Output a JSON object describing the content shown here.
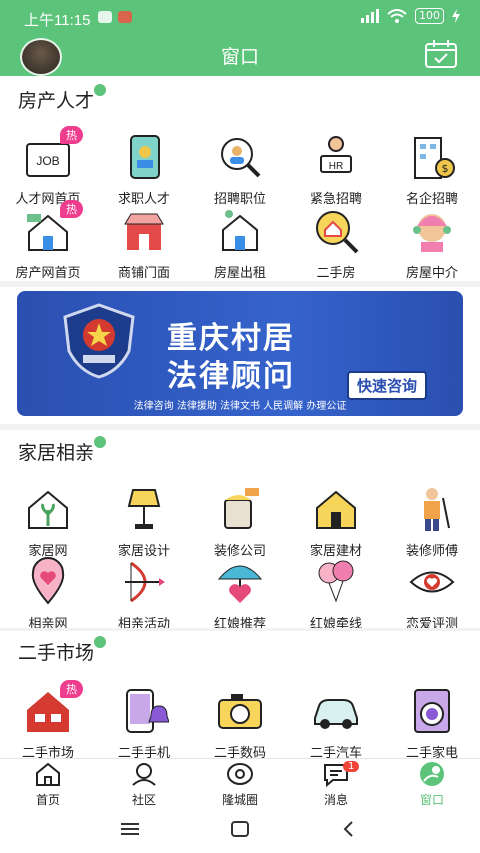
{
  "status": {
    "time": "上午11:15",
    "battery": "100"
  },
  "header": {
    "title": "窗口"
  },
  "sections": [
    {
      "title": "房产人才"
    },
    {
      "title": "家居相亲"
    },
    {
      "title": "二手市场"
    }
  ],
  "grid1": [
    {
      "label": "人才网首页",
      "badge": "热",
      "icon": "job-icon"
    },
    {
      "label": "求职人才",
      "icon": "phone-person-icon"
    },
    {
      "label": "招聘职位",
      "icon": "search-person-icon"
    },
    {
      "label": "紧急招聘",
      "icon": "hr-icon"
    },
    {
      "label": "名企招聘",
      "icon": "building-money-icon"
    },
    {
      "label": "房产网首页",
      "badge": "热",
      "icon": "house-money-icon"
    },
    {
      "label": "商铺门面",
      "icon": "shop-icon"
    },
    {
      "label": "房屋出租",
      "icon": "house-rent-icon"
    },
    {
      "label": "二手房",
      "icon": "house-search-icon"
    },
    {
      "label": "房屋中介",
      "icon": "agent-icon"
    }
  ],
  "banner": {
    "line1": "重庆村居",
    "line2": "法律顾问",
    "cta": "快速咨询",
    "sub": "法律咨询 法律援助 法律文书 人民调解 办理公证"
  },
  "grid2": [
    {
      "label": "家居网",
      "icon": "home-plant-icon"
    },
    {
      "label": "家居设计",
      "icon": "lamp-icon"
    },
    {
      "label": "装修公司",
      "icon": "paint-icon"
    },
    {
      "label": "家居建材",
      "icon": "house-tools-icon"
    },
    {
      "label": "装修师傅",
      "icon": "worker-icon"
    },
    {
      "label": "相亲网",
      "icon": "heart-pin-icon"
    },
    {
      "label": "相亲活动",
      "icon": "cupid-bow-icon"
    },
    {
      "label": "红娘推荐",
      "icon": "umbrella-heart-icon"
    },
    {
      "label": "红娘牵线",
      "icon": "balloons-icon"
    },
    {
      "label": "恋爱评测",
      "icon": "eye-heart-icon"
    }
  ],
  "grid3": [
    {
      "label": "二手市场",
      "badge": "热",
      "icon": "market-house-icon"
    },
    {
      "label": "二手手机",
      "icon": "phone-bell-icon"
    },
    {
      "label": "二手数码",
      "icon": "camera-icon"
    },
    {
      "label": "二手汽车",
      "icon": "car-icon"
    },
    {
      "label": "二手家电",
      "icon": "washer-icon"
    }
  ],
  "tabs": [
    {
      "label": "首页",
      "icon": "home-icon"
    },
    {
      "label": "社区",
      "icon": "community-icon"
    },
    {
      "label": "隆城圈",
      "icon": "circle-icon"
    },
    {
      "label": "消息",
      "icon": "message-icon",
      "badge": "1"
    },
    {
      "label": "窗口",
      "icon": "window-icon",
      "active": true
    }
  ],
  "colors": {
    "brand": "#5cc37a",
    "hot": "#ee3d8d",
    "banner": "#2a4fb0"
  }
}
